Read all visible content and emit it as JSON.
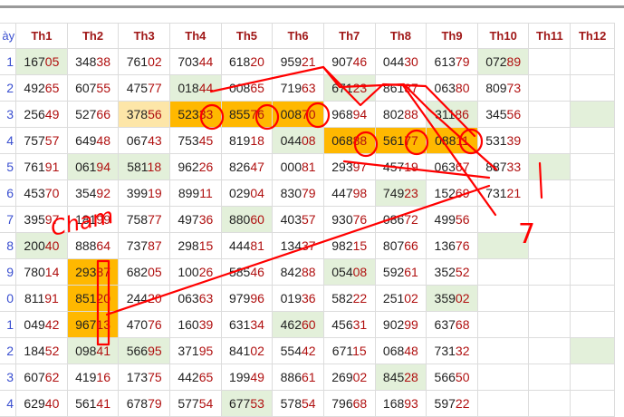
{
  "columns": [
    "ày",
    "Th1",
    "Th2",
    "Th3",
    "Th4",
    "Th5",
    "Th6",
    "Th7",
    "Th8",
    "Th9",
    "Th10",
    "Th11",
    "Th12"
  ],
  "rows": [
    {
      "day": "1",
      "cells": [
        "16705",
        "34838",
        "76102",
        "70344",
        "61820",
        "95921",
        "90746",
        "04430",
        "61379",
        "07289",
        "",
        ""
      ]
    },
    {
      "day": "2",
      "cells": [
        "49265",
        "60755",
        "47577",
        "01844",
        "00865",
        "71963",
        "67123",
        "86137",
        "06380",
        "80973",
        "",
        ""
      ]
    },
    {
      "day": "3",
      "cells": [
        "25649",
        "52766",
        "37856",
        "52333",
        "85576",
        "00870",
        "96894",
        "80288",
        "31186",
        "34556",
        "",
        ""
      ]
    },
    {
      "day": "4",
      "cells": [
        "75757",
        "64948",
        "06743",
        "75345",
        "81918",
        "04408",
        "06888",
        "56177",
        "08811",
        "53139",
        "",
        ""
      ]
    },
    {
      "day": "5",
      "cells": [
        "76191",
        "06194",
        "58118",
        "96226",
        "82647",
        "00081",
        "29397",
        "45719",
        "06367",
        "88733",
        "",
        ""
      ]
    },
    {
      "day": "6",
      "cells": [
        "45370",
        "35492",
        "39919",
        "89911",
        "02904",
        "83079",
        "44798",
        "74923",
        "15269",
        "73121",
        "",
        ""
      ]
    },
    {
      "day": "7",
      "cells": [
        "39597",
        "18199",
        "75877",
        "49736",
        "88060",
        "40357",
        "93076",
        "08672",
        "49956",
        "",
        "",
        ""
      ]
    },
    {
      "day": "8",
      "cells": [
        "20040",
        "88864",
        "73787",
        "29815",
        "44481",
        "13437",
        "98215",
        "80766",
        "13676",
        "",
        "",
        ""
      ]
    },
    {
      "day": "9",
      "cells": [
        "78014",
        "29387",
        "68205",
        "10026",
        "58546",
        "84288",
        "05408",
        "59261",
        "35252",
        "",
        "",
        ""
      ]
    },
    {
      "day": "0",
      "cells": [
        "81191",
        "85120",
        "24420",
        "06363",
        "97996",
        "01936",
        "58222",
        "25102",
        "35902",
        "",
        "",
        ""
      ]
    },
    {
      "day": "1",
      "cells": [
        "04942",
        "96713",
        "47076",
        "16039",
        "63134",
        "46260",
        "45631",
        "90299",
        "63768",
        "",
        "",
        ""
      ]
    },
    {
      "day": "2",
      "cells": [
        "18452",
        "09841",
        "56695",
        "37195",
        "84102",
        "55442",
        "67115",
        "06848",
        "73132",
        "",
        "",
        ""
      ]
    },
    {
      "day": "3",
      "cells": [
        "60762",
        "41916",
        "17375",
        "44265",
        "19949",
        "88661",
        "26902",
        "84528",
        "56650",
        "",
        "",
        ""
      ]
    },
    {
      "day": "4",
      "cells": [
        "62940",
        "56141",
        "67879",
        "57754",
        "67753",
        "57854",
        "79668",
        "16893",
        "59722",
        "",
        "",
        ""
      ]
    }
  ],
  "shading": [
    [
      "g",
      "e",
      "e",
      "e",
      "e",
      "e",
      "e",
      "e",
      "e",
      "g",
      "e",
      "e"
    ],
    [
      "e",
      "e",
      "e",
      "g",
      "e",
      "e",
      "g",
      "e",
      "e",
      "e",
      "e",
      "e"
    ],
    [
      "e",
      "e",
      "ly",
      "y",
      "y",
      "y",
      "e",
      "e",
      "g",
      "e",
      "e",
      "g"
    ],
    [
      "e",
      "e",
      "e",
      "e",
      "e",
      "g",
      "y",
      "y",
      "y",
      "e",
      "e",
      "e"
    ],
    [
      "e",
      "g",
      "g",
      "e",
      "e",
      "e",
      "e",
      "e",
      "e",
      "e",
      "g",
      "e"
    ],
    [
      "e",
      "e",
      "e",
      "e",
      "e",
      "e",
      "e",
      "g",
      "e",
      "e",
      "e",
      "e"
    ],
    [
      "e",
      "e",
      "e",
      "e",
      "g",
      "e",
      "e",
      "e",
      "e",
      "e",
      "e",
      "e"
    ],
    [
      "g",
      "e",
      "e",
      "e",
      "e",
      "e",
      "e",
      "e",
      "e",
      "g",
      "e",
      "e"
    ],
    [
      "e",
      "y",
      "e",
      "e",
      "e",
      "e",
      "g",
      "e",
      "e",
      "e",
      "e",
      "e"
    ],
    [
      "e",
      "y",
      "e",
      "e",
      "e",
      "e",
      "e",
      "e",
      "g",
      "e",
      "e",
      "e"
    ],
    [
      "e",
      "y",
      "e",
      "e",
      "e",
      "g",
      "e",
      "e",
      "e",
      "e",
      "e",
      "e"
    ],
    [
      "e",
      "g",
      "g",
      "e",
      "e",
      "e",
      "e",
      "e",
      "e",
      "e",
      "e",
      "g"
    ],
    [
      "e",
      "e",
      "e",
      "e",
      "e",
      "e",
      "e",
      "g",
      "e",
      "e",
      "e",
      "e"
    ],
    [
      "e",
      "e",
      "e",
      "e",
      "g",
      "e",
      "e",
      "e",
      "e",
      "e",
      "e",
      "e"
    ]
  ],
  "annotations": {
    "text_left": "Cham",
    "text_right": "7",
    "ink_color": "#ff0000"
  },
  "colors": {
    "header_text": "#a01818",
    "day_text": "#3a4fd0",
    "highlight_strong": "#ffb800",
    "highlight_light": "#fde6a8",
    "highlight_green": "#e3f0da"
  }
}
